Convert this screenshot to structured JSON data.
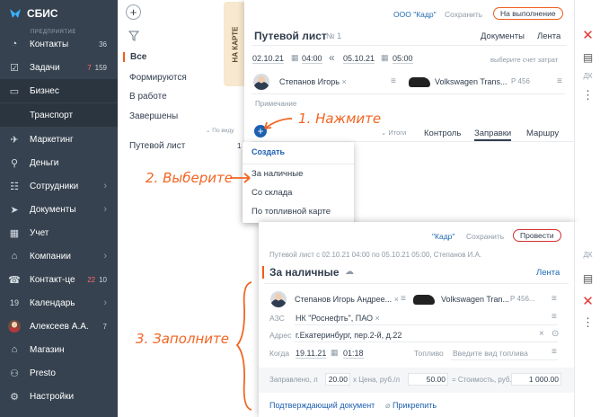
{
  "app": {
    "name": "СБИС",
    "section_caption": "ПРЕДПРИЯТИЕ"
  },
  "sidebar": {
    "items": [
      {
        "label": "Контакты",
        "count": "36",
        "icon": "chat-icon"
      },
      {
        "label": "Задачи",
        "count_red": "7",
        "count": "159",
        "icon": "tasks-icon"
      },
      {
        "label": "Бизнес",
        "icon": "briefcase-icon"
      },
      {
        "label": "Транспорт"
      },
      {
        "label": "Маркетинг",
        "icon": "megaphone-icon"
      },
      {
        "label": "Деньги",
        "icon": "money-icon"
      },
      {
        "label": "Сотрудники",
        "icon": "people-icon",
        "chevron": "›"
      },
      {
        "label": "Документы",
        "icon": "paper-plane-icon",
        "chevron": "›"
      },
      {
        "label": "Учет",
        "icon": "ledger-icon"
      },
      {
        "label": "Компании",
        "icon": "company-icon",
        "chevron": "›"
      },
      {
        "label": "Контакт-це",
        "count_red": "22",
        "count": "10",
        "icon": "headset-icon"
      },
      {
        "label": "Календарь",
        "icon": "calendar-icon",
        "day": "19",
        "chevron": "›"
      },
      {
        "label": "Алексеев А.А.",
        "count": "7",
        "icon": "avatar"
      },
      {
        "label": "Магазин",
        "icon": "shop-icon"
      },
      {
        "label": "Presto",
        "icon": "presto-icon"
      },
      {
        "label": "Настройки",
        "icon": "gear-icon"
      }
    ]
  },
  "filter": {
    "add": "+",
    "items": [
      "Все",
      "Формируются",
      "В работе",
      "Завершены"
    ],
    "sort_hint": "По виду",
    "group": "Путевой лист",
    "group_count": "1"
  },
  "map_tab": "НА КАРТЕ",
  "card1": {
    "org": "ООО \"Кадр\"",
    "save": "Сохранить",
    "status": "На выполнение",
    "title": "Путевой лист",
    "number": "№ 1",
    "docs": "Документы",
    "feed": "Лента",
    "date_from": "02.10.21",
    "time_from": "04:00",
    "date_to": "05.10.21",
    "time_to": "05:00",
    "account_hint": "выберите счет затрат",
    "driver": "Степанов Игорь",
    "vehicle": "Volkswagen Trans...",
    "plate": "Р 456",
    "note_placeholder": "Примечание",
    "tabs": {
      "totals": "Итоги",
      "control": "Контроль",
      "fuel": "Заправки",
      "route": "Маршру"
    }
  },
  "menu": {
    "title": "Создать",
    "items": [
      "За наличные",
      "Со склада",
      "По топливной карте"
    ]
  },
  "card2": {
    "org": "\"Кадр\"",
    "save": "Сохранить",
    "action": "Провести",
    "subtitle": "Путевой лист с 02.10.21 04:00 по 05.10.21 05:00, Степанов И.А.",
    "title": "За наличные",
    "feed": "Лента",
    "driver": "Степанов Игорь Андрее...",
    "vehicle": "Volkswagen Tran...",
    "plate": "Р 456...",
    "station_label": "АЗС",
    "station": "НК \"Роснефть\", ПАО",
    "address_label": "Адрес",
    "address": "г.Екатеринбург, пер.2-й, д.22",
    "when_label": "Когда",
    "date": "19.11.21",
    "time": "01:18",
    "fuel_label": "Топливо",
    "fuel_placeholder": "Введите вид топлива",
    "refilled_label": "Заправлено, л",
    "liters": "20.00",
    "price_label": "x Цена, руб./л",
    "price": "50.00",
    "total_label": "= Стоимость, руб.",
    "total": "1 000.00",
    "doc_link": "Подтверждающий документ",
    "attach": "Прикрепить"
  },
  "annotations": {
    "step1": "1. Нажмите",
    "step2": "2. Выберите",
    "step3": "3. Заполните"
  },
  "colors": {
    "sidebar": "#36424f",
    "accent": "#f25c19",
    "link": "#1e6ab4",
    "annotation": "#f26522",
    "delete": "#e53935"
  }
}
